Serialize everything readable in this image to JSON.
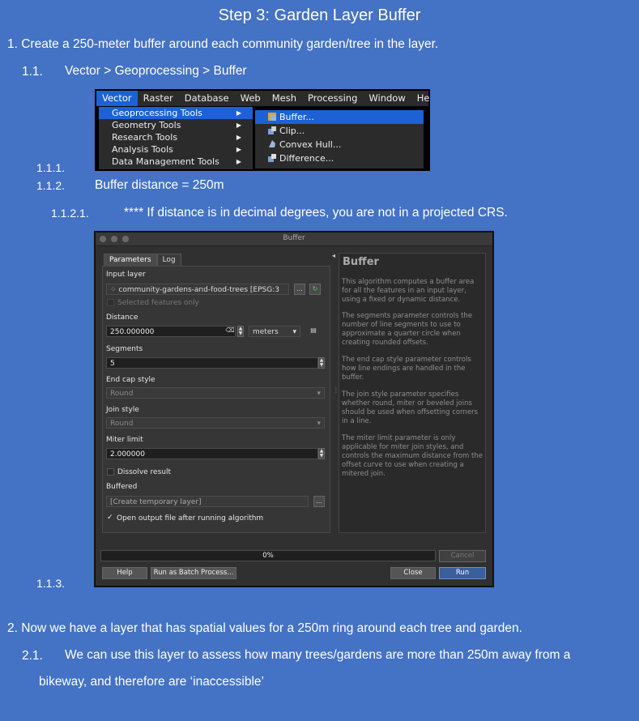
{
  "slide": {
    "title": "Step 3: Garden Layer Buffer",
    "p1": "1. Create a 250-meter buffer around each community garden/tree in the layer.",
    "s11_num": "1.1.",
    "s11_text": "Vector > Geoprocessing > Buffer",
    "s111_num": "1.1.1.",
    "s112_num": "1.1.2.",
    "s112_text": "Buffer distance = 250m",
    "s1121_num": "1.1.2.1.",
    "s1121_text": "**** If distance is in decimal degrees, you are not in a projected CRS.",
    "s113_num": "1.1.3.",
    "p2": "2. Now we have a layer that has spatial values for a 250m ring around each tree and garden.",
    "s21_num": "2.1.",
    "s21_text": "We can use this layer to assess how many trees/gardens are more than 250m away from a",
    "s21_cont": "bikeway, and therefore are ‘inaccessible’"
  },
  "menu": {
    "bar": [
      "Vector",
      "Raster",
      "Database",
      "Web",
      "Mesh",
      "Processing",
      "Window",
      "Help"
    ],
    "dropdown": [
      "Geoprocessing Tools",
      "Geometry Tools",
      "Research Tools",
      "Analysis Tools",
      "Data Management Tools"
    ],
    "submenu": [
      "Buffer...",
      "Clip...",
      "Convex Hull...",
      "Difference..."
    ]
  },
  "dialog": {
    "title": "Buffer",
    "tabs": [
      "Parameters",
      "Log"
    ],
    "input_layer_label": "Input layer",
    "input_layer_value": "community-gardens-and-food-trees [EPSG:3",
    "selected_only": "Selected features only",
    "distance_label": "Distance",
    "distance_value": "250.000000",
    "distance_unit": "meters",
    "segments_label": "Segments",
    "segments_value": "5",
    "endcap_label": "End cap style",
    "endcap_value": "Round",
    "join_label": "Join style",
    "join_value": "Round",
    "miter_label": "Miter limit",
    "miter_value": "2.000000",
    "dissolve": "Dissolve result",
    "buffered_label": "Buffered",
    "buffered_value": "[Create temporary layer]",
    "open_output": "Open output file after running algorithm",
    "progress": "0%",
    "cancel": "Cancel",
    "help": "Help",
    "batch": "Run as Batch Process...",
    "close": "Close",
    "run": "Run",
    "ellipsis": "...",
    "help_title": "Buffer",
    "help_texts": [
      "This algorithm computes a buffer area for all the features in an input layer, using a fixed or dynamic distance.",
      "The segments parameter controls the number of line segments to use to approximate a quarter circle when creating rounded offsets.",
      "The end cap style parameter controls how line endings are handled in the buffer.",
      "The join style parameter specifies whether round, miter or beveled joins should be used when offsetting corners in a line.",
      "The miter limit parameter is only applicable for miter join styles, and controls the maximum distance from the offset curve to use when creating a mitered join."
    ]
  }
}
